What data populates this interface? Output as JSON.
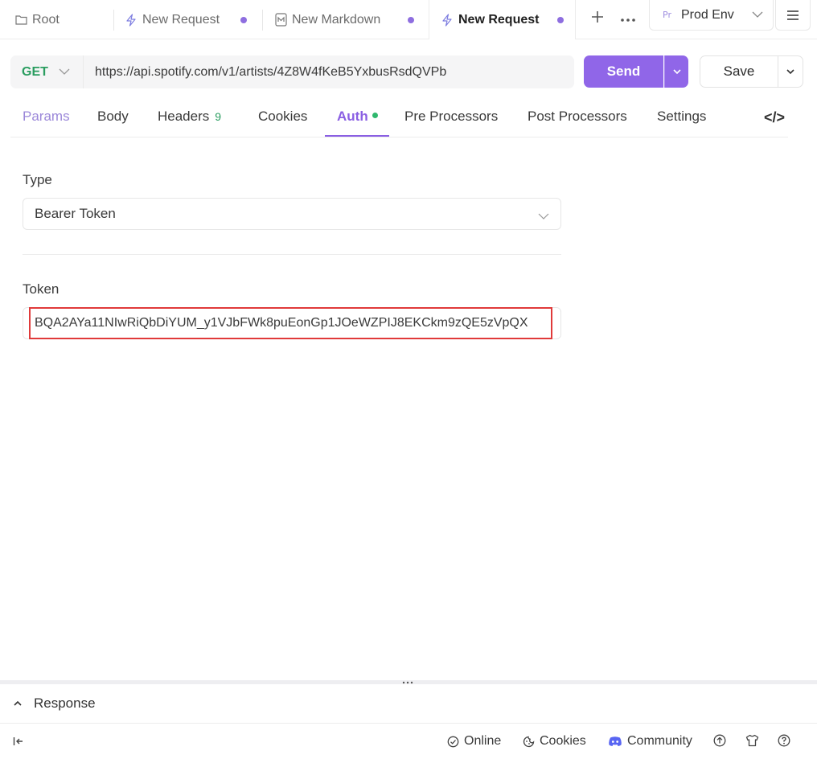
{
  "tabs": [
    {
      "label": "Root",
      "icon": "folder-icon"
    },
    {
      "label": "New Request",
      "icon": "bolt-icon",
      "unsaved": true
    },
    {
      "label": "New Markdown",
      "icon": "markdown-icon",
      "unsaved": true
    },
    {
      "label": "New Request",
      "icon": "bolt-icon",
      "unsaved": true,
      "active": true
    }
  ],
  "env": {
    "badge": "Pr",
    "label": "Prod Env"
  },
  "request": {
    "method": "GET",
    "url": "https://api.spotify.com/v1/artists/4Z8W4fKeB5YxbusRsdQVPb",
    "send_label": "Send",
    "save_label": "Save"
  },
  "subtabs": {
    "params": "Params",
    "body": "Body",
    "headers": "Headers",
    "headers_count": "9",
    "cookies": "Cookies",
    "auth": "Auth",
    "pre": "Pre Processors",
    "post": "Post Processors",
    "settings": "Settings",
    "code": "</>"
  },
  "auth": {
    "type_label": "Type",
    "type_value": "Bearer Token",
    "token_label": "Token",
    "token_value": "BQA2AYa11NIwRiQbDiYUM_y1VJbFWk8puEonGp1JOeWZPIJ8EKCkm9zQE5zVpQX"
  },
  "response": {
    "label": "Response"
  },
  "status": {
    "online": "Online",
    "cookies": "Cookies",
    "community": "Community"
  },
  "colors": {
    "accent": "#9066e8",
    "get_method": "#2a9d60",
    "highlight": "#e03a3a"
  }
}
